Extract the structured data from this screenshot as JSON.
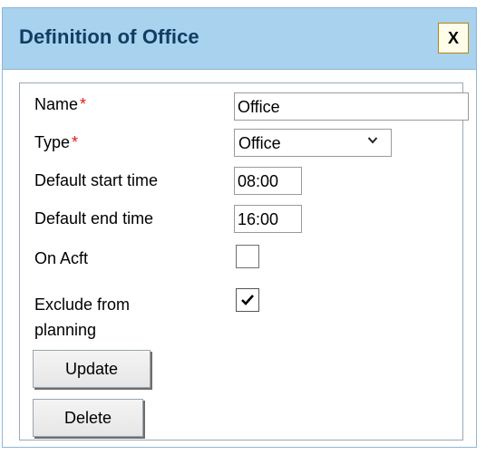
{
  "dialog": {
    "title": "Definition of Office",
    "close_label": "X"
  },
  "form": {
    "name": {
      "label": "Name",
      "required_mark": "*",
      "value": "Office"
    },
    "type": {
      "label": "Type",
      "required_mark": "*",
      "value": "Office"
    },
    "default_start_time": {
      "label": "Default start time",
      "value": "08:00"
    },
    "default_end_time": {
      "label": "Default end time",
      "value": "16:00"
    },
    "on_acft": {
      "label": "On Acft",
      "checked": false
    },
    "exclude_from_planning": {
      "label_line1": "Exclude from",
      "label_line2": "planning",
      "checked": true
    }
  },
  "buttons": {
    "update": "Update",
    "delete": "Delete"
  },
  "colors": {
    "title_bar": "#a8d2ee",
    "title_text": "#123d63",
    "required": "#e31a1c"
  },
  "icons": {
    "select_arrow": "chevron-down-icon",
    "checked_box": "checkmark-icon"
  }
}
